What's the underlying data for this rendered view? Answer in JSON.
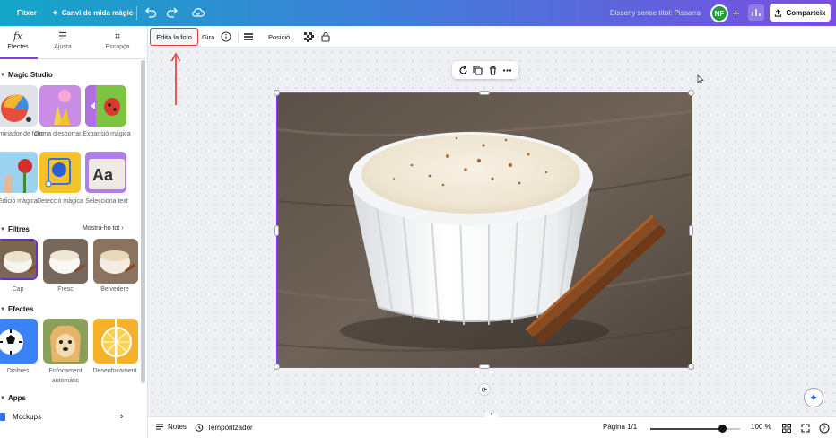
{
  "topbar": {
    "file_label": "Fitxer",
    "resize_label": "Canvi de mida màgic",
    "doc_title": "Disseny sense títol: Pissarra",
    "avatar_initials": "NF",
    "plus_label": "+",
    "share_label": "Comparteix"
  },
  "sidebar": {
    "tabs": [
      {
        "label": "Efectes",
        "icon": "fx-icon",
        "glyph": "fx"
      },
      {
        "label": "Ajusta",
        "icon": "sliders-icon",
        "glyph": "☰"
      },
      {
        "label": "Escapça",
        "icon": "crop-icon",
        "glyph": "⌗"
      }
    ],
    "magic_studio_title": "Magic Studio",
    "magic_studio": [
      {
        "label": "Eliminador de fons"
      },
      {
        "label": "Goma d'esborrar..."
      },
      {
        "label": "Expansió màgica"
      },
      {
        "label": "Edició màgica"
      },
      {
        "label": "Detecció màgica"
      },
      {
        "label": "Selecciona text"
      }
    ],
    "filters_title": "Filtres",
    "filters_show_all": "Mostra-ho tot",
    "filters": [
      {
        "label": "Cap"
      },
      {
        "label": "Fresc"
      },
      {
        "label": "Belvedere"
      }
    ],
    "effects_title": "Efectes",
    "effects": [
      {
        "label": "Ombres"
      },
      {
        "label": "Enfocament automàtic"
      },
      {
        "label": "Desenfocament"
      }
    ],
    "apps_title": "Apps",
    "apps_item": "Mockups"
  },
  "context_toolbar": {
    "edit_photo": "Edita la foto",
    "rotate": "Gira",
    "position": "Posició"
  },
  "bottom": {
    "notes": "Notes",
    "timer": "Temporitzador",
    "page": "Pàgina 1/1",
    "zoom": "100 %",
    "zoom_level": 0.8
  },
  "colors": {
    "accent": "#8b3dff",
    "highlight": "#e03a3a"
  }
}
